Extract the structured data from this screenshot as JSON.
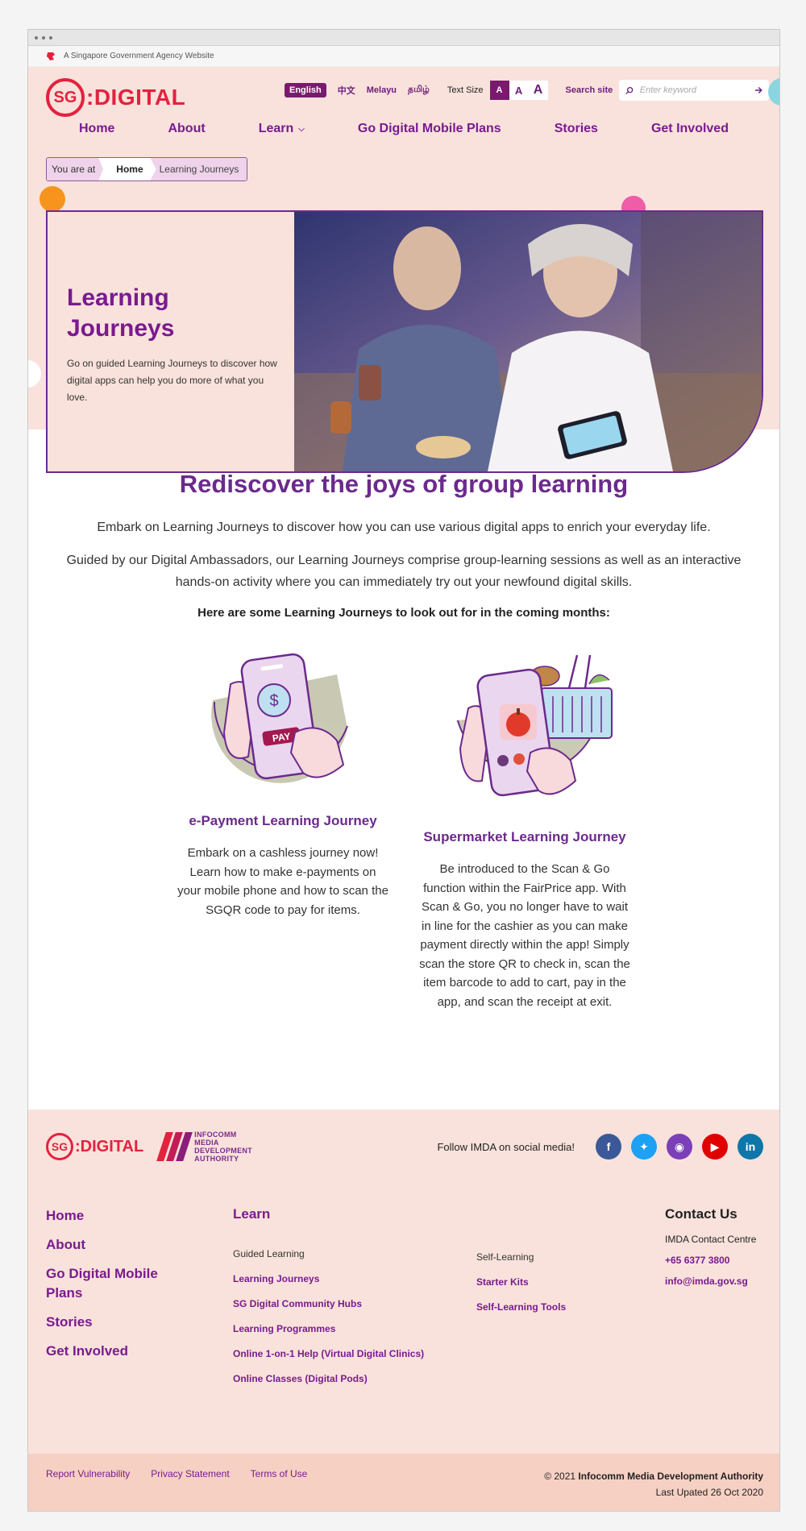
{
  "gov_bar": {
    "text": "A Singapore Government Agency Website"
  },
  "logo": {
    "badge": "SG",
    "word": ":DIGITAL"
  },
  "languages": [
    "English",
    "中文",
    "Melayu",
    "தமிழ்"
  ],
  "text_size": {
    "label": "Text Size",
    "small": "A",
    "medium": "A",
    "large": "A"
  },
  "search": {
    "label": "Search site",
    "placeholder": "Enter keyword"
  },
  "nav": [
    "Home",
    "About",
    "Learn",
    "Go Digital Mobile Plans",
    "Stories",
    "Get Involved"
  ],
  "breadcrumb": {
    "label": "You are at",
    "home": "Home",
    "current": "Learning Journeys"
  },
  "hero": {
    "title_line1": "Learning",
    "title_line2": "Journeys",
    "desc": "Go on guided Learning Journeys to discover how digital apps can help you do more of what you love."
  },
  "main": {
    "heading": "Rediscover the joys of group learning",
    "lead": "Embark on Learning Journeys to discover how you can use various digital apps to enrich your everyday life.",
    "para": "Guided by our Digital Ambassadors, our Learning Journeys comprise group-learning sessions as well as an interactive hands-on activity where you can immediately try out your newfound digital skills.",
    "bold_line": "Here are some Learning Journeys to look out for in the coming months:"
  },
  "cards": [
    {
      "title": "e-Payment Learning Journey",
      "badge": "PAY",
      "desc": "Embark on a cashless journey now! Learn how to make e-payments on your mobile phone and how to scan the SGQR code to pay for items."
    },
    {
      "title": "Supermarket Learning Journey",
      "desc": "Be introduced to the Scan & Go function within the FairPrice app. With Scan & Go, you no longer have to wait in line for the cashier as you can make payment directly within the app! Simply scan the store QR to check in, scan the item barcode to add to cart, pay in the app, and scan the receipt at exit."
    }
  ],
  "footer": {
    "imda_text": [
      "INFOCOMM",
      "MEDIA",
      "DEVELOPMENT",
      "AUTHORITY"
    ],
    "social_label": "Follow IMDA on social media!",
    "social_icons": [
      "facebook-icon",
      "twitter-icon",
      "instagram-icon",
      "youtube-icon",
      "linkedin-icon"
    ],
    "social_colors": [
      "#3b5998",
      "#1da1f2",
      "#7b3fb7",
      "#e00000",
      "#0e76a8"
    ],
    "col1": [
      "Home",
      "About",
      "Go Digital Mobile Plans",
      "Stories",
      "Get Involved"
    ],
    "learn_heading": "Learn",
    "guided_heading": "Guided Learning",
    "guided_links": [
      "Learning Journeys",
      "SG Digital Community Hubs",
      "Learning Programmes",
      "Online 1-on-1 Help (Virtual Digital Clinics)",
      "Online Classes (Digital Pods)"
    ],
    "self_heading": "Self-Learning",
    "self_links": [
      "Starter Kits",
      "Self-Learning Tools"
    ],
    "contact_heading": "Contact Us",
    "contact_name": "IMDA Contact Centre",
    "contact_phone": "+65 6377 3800",
    "contact_email": "info@imda.gov.sg"
  },
  "bottom": {
    "links": [
      "Report Vulnerability",
      "Privacy Statement",
      "Terms of Use"
    ],
    "copyright_prefix": "© 2021",
    "copyright_org": "Infocomm Media Development Authority",
    "last_updated": "Last Upated 26 Oct 2020"
  },
  "colors": {
    "brand_red": "#e2233e",
    "brand_purple": "#7a1a8f",
    "header_bg": "#f9e2db"
  }
}
